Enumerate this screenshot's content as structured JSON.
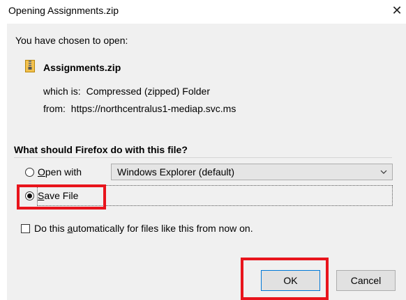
{
  "dialog": {
    "title": "Opening Assignments.zip",
    "close_glyph": "✕"
  },
  "intro": "You have chosen to open:",
  "file": {
    "name": "Assignments.zip",
    "icon": "zip-folder-icon",
    "type_label": "which is:",
    "type_value": "Compressed (zipped) Folder",
    "from_label": "from:",
    "from_value": "https://northcentralus1-mediap.svc.ms"
  },
  "question": "What should Firefox do with this file?",
  "options": {
    "open_with": {
      "accel": "O",
      "rest": "pen with",
      "selected": false
    },
    "open_with_app": "Windows Explorer (default)",
    "save_file": {
      "accel": "S",
      "rest": "ave File",
      "selected": true
    }
  },
  "auto_checkbox": {
    "before": "Do this ",
    "accel": "a",
    "after": "utomatically for files like this from now on.",
    "checked": false
  },
  "buttons": {
    "ok": "OK",
    "cancel": "Cancel"
  },
  "colors": {
    "highlight": "#e8141c",
    "client_bg": "#f0f0f0",
    "default_button_border": "#0078d7"
  }
}
